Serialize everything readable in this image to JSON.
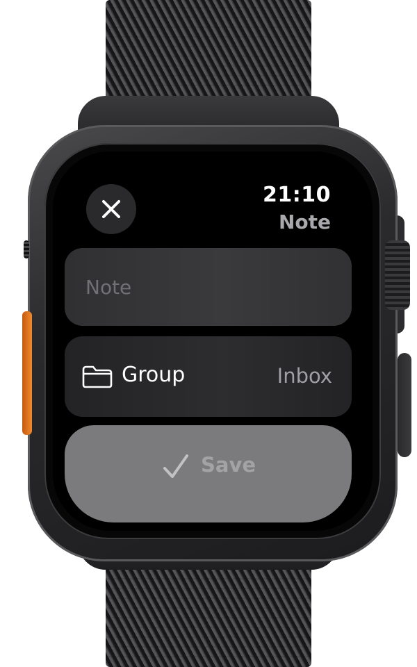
{
  "status": {
    "time": "21:10",
    "title": "Note"
  },
  "form": {
    "note_placeholder": "Note",
    "note_value": "",
    "group_label": "Group",
    "group_value": "Inbox",
    "save_label": "Save"
  },
  "icons": {
    "close": "close-icon",
    "folder": "folder-icon",
    "check": "checkmark-icon"
  },
  "colors": {
    "accent_orange": "#f08a2e",
    "save_bg": "#7b7b7d",
    "secondary_text": "#a9a9ad"
  }
}
